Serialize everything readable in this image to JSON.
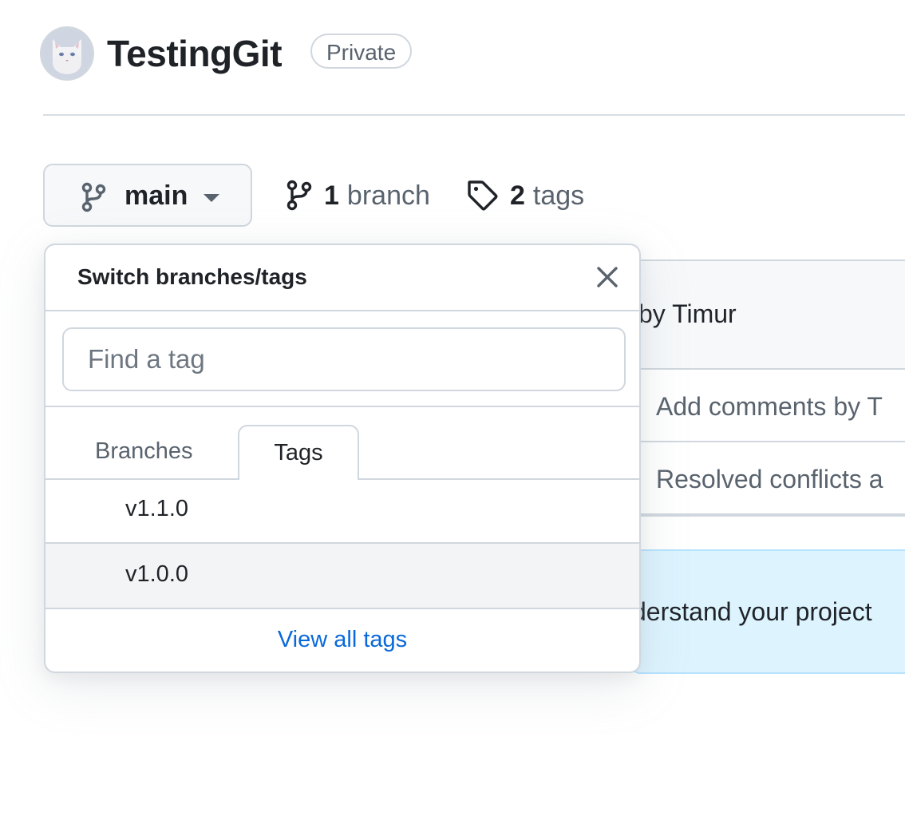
{
  "repo": {
    "name": "TestingGit",
    "visibility": "Private"
  },
  "toolbar": {
    "current_branch": "main",
    "branch_count": "1",
    "branch_word": "branch",
    "tag_count": "2",
    "tag_word": "tags"
  },
  "background": {
    "latest_commit_partial": "by Timur",
    "file_rows": [
      {
        "commit_message_partial": "Add comments by T"
      },
      {
        "commit_message_partial": "Resolved conflicts a"
      }
    ],
    "readme_banner_partial": "derstand your project"
  },
  "dropdown": {
    "title": "Switch branches/tags",
    "filter_placeholder": "Find a tag",
    "tabs": {
      "branches_label": "Branches",
      "tags_label": "Tags",
      "selected": "Tags"
    },
    "items": [
      {
        "label": "v1.1.0"
      },
      {
        "label": "v1.0.0"
      }
    ],
    "hovered_item": "v1.0.0",
    "footer_link": "View all tags"
  },
  "colors": {
    "link": "#0969da",
    "text_primary": "#1f2328",
    "text_muted": "#59636e",
    "border": "#d0d7de",
    "banner_bg": "#ddf4ff"
  }
}
